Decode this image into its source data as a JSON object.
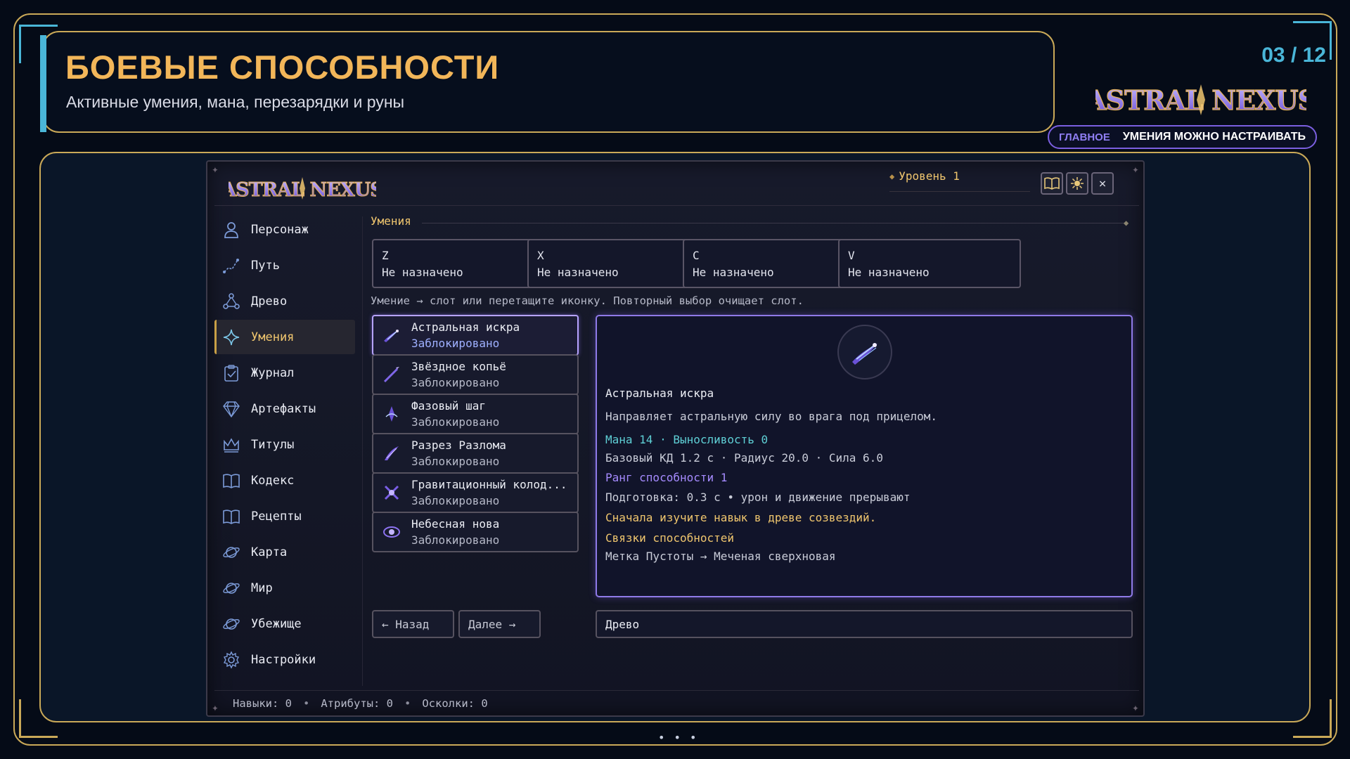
{
  "slide": {
    "title": "БОЕВЫЕ СПОСОБНОСТИ",
    "subtitle": "Активные умения, мана, перезарядки и руны",
    "counter": "03 / 12",
    "brand": "ASTRAL NEXUS",
    "tag_main": "ГЛАВНОЕ",
    "tag_note": "УМЕНИЯ МОЖНО НАСТРАИВАТЬ",
    "pager": "• • •"
  },
  "game": {
    "logo": "ASTRAL NEXUS",
    "level": "Уровень 1",
    "window_buttons": [
      {
        "icon": "book-icon"
      },
      {
        "icon": "sun-icon"
      },
      {
        "icon": "close-icon",
        "glyph": "×"
      }
    ],
    "sidebar": [
      {
        "label": "Персонаж",
        "icon": "person-icon"
      },
      {
        "label": "Путь",
        "icon": "path-icon"
      },
      {
        "label": "Древо",
        "icon": "tree-icon"
      },
      {
        "label": "Умения",
        "icon": "star-icon",
        "active": true
      },
      {
        "label": "Журнал",
        "icon": "journal-icon"
      },
      {
        "label": "Артефакты",
        "icon": "gem-icon"
      },
      {
        "label": "Титулы",
        "icon": "crown-icon"
      },
      {
        "label": "Кодекс",
        "icon": "book-icon"
      },
      {
        "label": "Рецепты",
        "icon": "book-icon"
      },
      {
        "label": "Карта",
        "icon": "planet-icon"
      },
      {
        "label": "Мир",
        "icon": "planet-icon"
      },
      {
        "label": "Убежище",
        "icon": "planet-icon"
      },
      {
        "label": "Настройки",
        "icon": "gear-icon"
      }
    ],
    "section_title": "Умения",
    "slots": [
      {
        "key": "Z",
        "value": "Не назначено"
      },
      {
        "key": "X",
        "value": "Не назначено"
      },
      {
        "key": "C",
        "value": "Не назначено"
      },
      {
        "key": "V",
        "value": "Не назначено"
      }
    ],
    "hint": "Умение → слот или перетащите иконку. Повторный выбор очищает слот.",
    "skills": [
      {
        "name": "Астральная искра",
        "status": "Заблокировано",
        "active": true
      },
      {
        "name": "Звёздное копьё",
        "status": "Заблокировано"
      },
      {
        "name": "Фазовый шаг",
        "status": "Заблокировано"
      },
      {
        "name": "Разрез Разлома",
        "status": "Заблокировано"
      },
      {
        "name": "Гравитационный колод...",
        "status": "Заблокировано"
      },
      {
        "name": "Небесная нова",
        "status": "Заблокировано"
      }
    ],
    "detail": {
      "name": "Астральная искра",
      "description": "Направляет астральную силу во врага под прицелом.",
      "cost": "Мана 14 · Выносливость 0",
      "base": "Базовый КД 1.2 с · Радиус 20.0 · Сила 6.0",
      "rank": "Ранг способности 1",
      "prep": "Подготовка: 0.3 с • урон и движение прерывают",
      "requirement": "Сначала изучите навык в древе созвездий.",
      "links_header": "Связки способностей",
      "links": "Метка Пустоты → Меченая сверхновая"
    },
    "nav": {
      "back": "← Назад",
      "next": "Далее →",
      "tree_field": "Древо"
    },
    "status": {
      "skills": "Навыки: 0",
      "attributes": "Атрибуты: 0",
      "shards": "Осколки: 0",
      "sep": "•"
    }
  },
  "colors": {
    "gold": "#caa958",
    "cyan": "#4ab6d8",
    "title": "#f2b659",
    "violet": "#8f7ae8",
    "teal": "#5fd0d6"
  }
}
